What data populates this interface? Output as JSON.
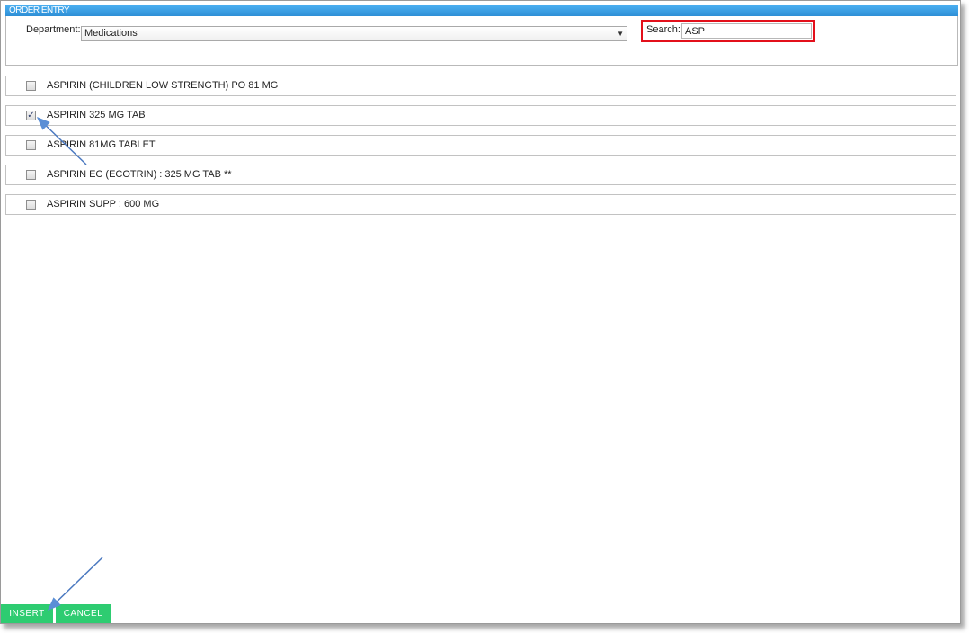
{
  "window": {
    "title": "ORDER ENTRY"
  },
  "header": {
    "department_label": "Department:",
    "department_value": "Medications",
    "search_label": "Search:",
    "search_value": "ASP",
    "highlight_color": "#e3101b"
  },
  "items": [
    {
      "label": "ASPIRIN (CHILDREN LOW STRENGTH) PO 81 MG",
      "checked": false
    },
    {
      "label": "ASPIRIN 325 MG TAB",
      "checked": true
    },
    {
      "label": "ASPIRIN 81MG TABLET",
      "checked": false
    },
    {
      "label": "ASPIRIN EC (ECOTRIN) : 325 MG TAB **",
      "checked": false
    },
    {
      "label": "ASPIRIN SUPP : 600 MG",
      "checked": false
    }
  ],
  "buttons": {
    "insert_label": "INSERT",
    "cancel_label": "CANCEL",
    "button_color": "#2ecc71"
  },
  "icons": {
    "dropdown": "chevron-down-icon",
    "annotation": "arrow-pointer-icon"
  }
}
